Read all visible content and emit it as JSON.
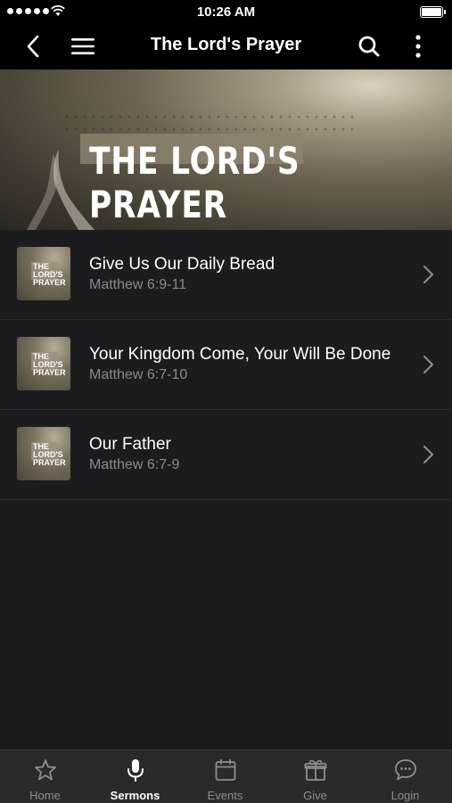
{
  "status_bar": {
    "time": "10:26 AM"
  },
  "nav": {
    "title": "The Lord's Prayer"
  },
  "hero": {
    "title": "THE LORD'S PRAYER"
  },
  "sermons": [
    {
      "title": "Give Us Our Daily Bread",
      "reference": "Matthew 6:9-11",
      "thumb_text": "THE LORD'S PRAYER"
    },
    {
      "title": "Your Kingdom Come, Your Will Be Done",
      "reference": "Matthew 6:7-10",
      "thumb_text": "THE LORD'S PRAYER"
    },
    {
      "title": "Our Father",
      "reference": "Matthew 6:7-9",
      "thumb_text": "THE LORD'S PRAYER"
    }
  ],
  "tabs": [
    {
      "label": "Home",
      "icon": "star-icon"
    },
    {
      "label": "Sermons",
      "icon": "microphone-icon",
      "active": true
    },
    {
      "label": "Events",
      "icon": "calendar-icon"
    },
    {
      "label": "Give",
      "icon": "gift-icon"
    },
    {
      "label": "Login",
      "icon": "chat-bubble-icon"
    }
  ],
  "colors": {
    "background": "#1c1c1e",
    "bar": "#000000",
    "tabbar": "#2a2a2c",
    "subtitle": "#8a8a8e",
    "inactive_tab": "#8e8e93"
  }
}
